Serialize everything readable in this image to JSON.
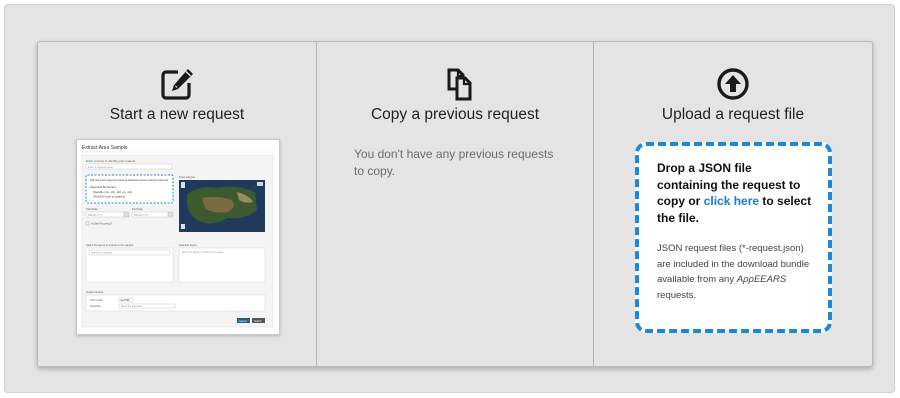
{
  "cards": {
    "new_request": {
      "title": "Start a new request",
      "icon": "edit-icon",
      "preview": {
        "heading": "Extract Area Sample",
        "field_label": "Enter a name to identify your request",
        "field_placeholder": "Enter a request name",
        "upload_hint": "Drag & drop a vector polygon file containing the area/features of interest or click here to select a file",
        "supported_label": "Supported file formats:",
        "supported_items": [
          "Shapefile (.zip, .shp, .dbf, .prj, .shx)",
          "GeoJSON (.json or .geojson)"
        ],
        "draw_label": "Draw polygon",
        "start_label": "Start Date",
        "end_label": "End Date",
        "start_value": "MM-DD-YYYY",
        "end_value": "MM-DD-YYYY",
        "recurring_label": "Is Date Recurring?",
        "layers_label": "Select the layers to include in the sample",
        "layers_placeholder": "Search for a product",
        "selected_label": "Selected layers",
        "selected_hint": "Select the layers to include in the sample",
        "output_label": "Output Options",
        "format_label": "File Format:",
        "format_value": "GeoTIFF",
        "projection_label": "Projection:",
        "projection_value": "Select the projection",
        "cancel_label": "Cancel",
        "submit_label": "Submit"
      }
    },
    "copy_request": {
      "title": "Copy a previous request",
      "icon": "copy-icon",
      "empty_message": "You don't have any previous requests to copy."
    },
    "upload_request": {
      "title": "Upload a request file",
      "icon": "upload-circle-icon",
      "drop_text_before": "Drop a JSON file containing the request to copy or ",
      "drop_link": "click here",
      "drop_text_after": " to select the file.",
      "sub_text_before": "JSON request files (*-request.json) are included in the download bundle available from any ",
      "brand": "AρρEEARS",
      "sub_text_after": " requests."
    }
  },
  "colors": {
    "accent": "#1e88d6",
    "link": "#1e7bc4",
    "panel_bg": "#e4e4e4"
  }
}
